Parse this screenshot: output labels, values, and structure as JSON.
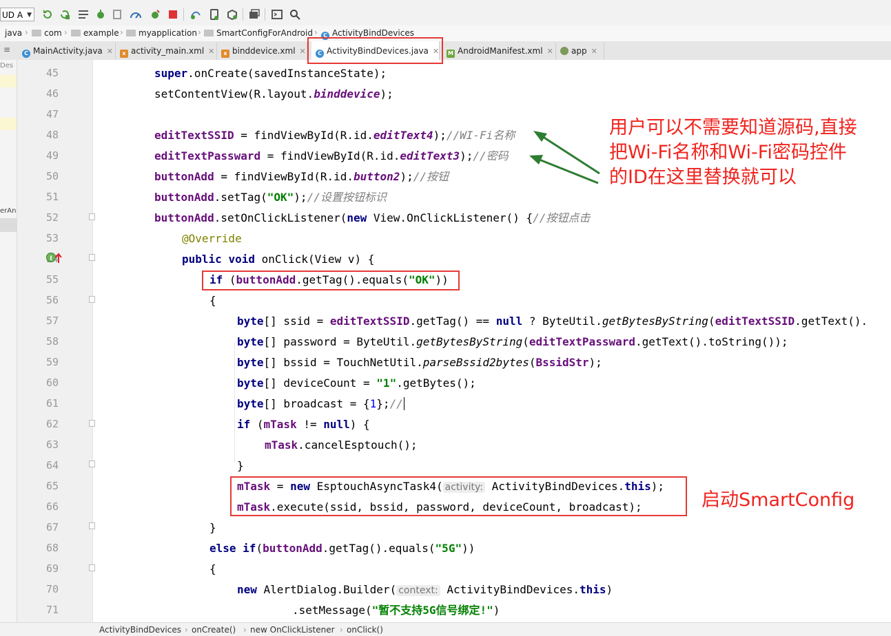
{
  "toolbar": {
    "run_config": "UD A"
  },
  "breadcrumb": [
    "java",
    "com",
    "example",
    "myapplication",
    "SmartConfigForAndroid",
    "ActivityBindDevices"
  ],
  "tabs": [
    {
      "label": "MainActivity.java",
      "icon": "c"
    },
    {
      "label": "activity_main.xml",
      "icon": "x"
    },
    {
      "label": "binddevice.xml",
      "icon": "x"
    },
    {
      "label": "ActivityBindDevices.java",
      "icon": "c",
      "active": true
    },
    {
      "label": "AndroidManifest.xml",
      "icon": "m"
    },
    {
      "label": "app",
      "icon": "a"
    }
  ],
  "left_panel": {
    "fragment_top": "Des",
    "fragment_mid": "erAnd"
  },
  "line_numbers": [
    "45",
    "46",
    "47",
    "48",
    "49",
    "50",
    "51",
    "52",
    "53",
    "54",
    "55",
    "56",
    "57",
    "58",
    "59",
    "60",
    "61",
    "62",
    "63",
    "64",
    "65",
    "66",
    "67",
    "68",
    "69",
    "70",
    "71"
  ],
  "code": {
    "l45": [
      "super",
      ".onCreate(savedInstanceState);"
    ],
    "l46": [
      "setContentView(R.layout.",
      "binddevice",
      ");"
    ],
    "l48": [
      "editTextSSID",
      " = findViewById(R.id.",
      "editText4",
      ");",
      "//WI-Fi名称"
    ],
    "l49": [
      "editTextPassward",
      " = findViewById(R.id.",
      "editText3",
      ");",
      "//密码"
    ],
    "l50": [
      "buttonAdd",
      " = findViewById(R.id.",
      "button2",
      ");",
      "//按钮"
    ],
    "l51": [
      "buttonAdd",
      ".setTag(",
      "\"OK\"",
      ");",
      "//设置按钮标识"
    ],
    "l52": [
      "buttonAdd",
      ".setOnClickListener(",
      "new",
      " View.OnClickListener() {",
      "//按钮点击"
    ],
    "l53": [
      "@Override"
    ],
    "l54": [
      "public",
      " ",
      "void",
      " onClick(View v) {"
    ],
    "l55": [
      "if",
      " (",
      "buttonAdd",
      ".getTag().equals(",
      "\"OK\"",
      "))"
    ],
    "l56": [
      "{"
    ],
    "l57": [
      "byte",
      "[] ssid = ",
      "editTextSSID",
      ".getTag() == ",
      "null",
      " ? ByteUtil.",
      "getBytesByString",
      "(",
      "editTextSSID",
      ".getText()."
    ],
    "l58": [
      "byte",
      "[] password = ByteUtil.",
      "getBytesByString",
      "(",
      "editTextPassward",
      ".getText().toString());"
    ],
    "l59": [
      "byte",
      "[] bssid = TouchNetUtil.",
      "parseBssid2bytes",
      "(",
      "BssidStr",
      ");"
    ],
    "l60": [
      "byte",
      "[] deviceCount = ",
      "\"1\"",
      ".getBytes();"
    ],
    "l61": [
      "byte",
      "[] broadcast = {",
      "1",
      "};",
      "//"
    ],
    "l62": [
      "if",
      " (",
      "mTask",
      " != ",
      "null",
      ") {"
    ],
    "l63": [
      "mTask",
      ".cancelEsptouch();"
    ],
    "l64": [
      "}"
    ],
    "l65": [
      "mTask",
      " = ",
      "new",
      " EsptouchAsyncTask4(",
      "activity:",
      " ActivityBindDevices.",
      "this",
      ");"
    ],
    "l66": [
      "mTask",
      ".execute(ssid, bssid, password, deviceCount, broadcast);"
    ],
    "l67": [
      "}"
    ],
    "l68": [
      "else",
      " ",
      "if",
      "(",
      "buttonAdd",
      ".getTag().equals(",
      "\"5G\"",
      "))"
    ],
    "l69": [
      "{"
    ],
    "l70": [
      "new",
      " AlertDialog.Builder(",
      "context:",
      " ActivityBindDevices.",
      "this",
      ")"
    ],
    "l71": [
      ".setMessage(",
      "\"暂不支持5G信号绑定!\"",
      ")"
    ]
  },
  "annotations": {
    "note1_lines": [
      "用户可以不需要知道源码,直接",
      "把Wi-Fi名称和Wi-Fi密码控件",
      "的ID在这里替换就可以"
    ],
    "note2": "启动SmartConfig"
  },
  "footer_crumbs": [
    "ActivityBindDevices",
    "onCreate()",
    "new OnClickListener",
    "onClick()"
  ],
  "colors": {
    "annotation_red": "#e53935",
    "arrow_green": "#2e7d32",
    "caret_line": "#fcfae1"
  }
}
